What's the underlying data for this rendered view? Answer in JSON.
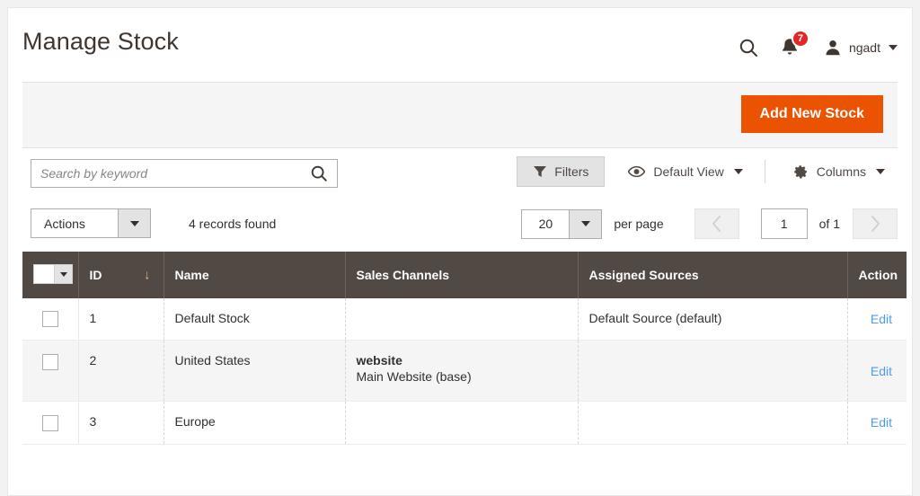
{
  "header": {
    "title": "Manage Stock",
    "search_icon": "search-icon",
    "notifications": {
      "icon": "bell-icon",
      "count": "7"
    },
    "user": {
      "avatar_icon": "user-icon",
      "name": "ngadt",
      "caret_icon": "chevron-down-icon"
    }
  },
  "action_band": {
    "add_new_stock_label": "Add New Stock",
    "primary_color": "#eb5202"
  },
  "toolbar": {
    "search_placeholder": "Search by keyword",
    "search_value": "",
    "search_icon": "search-icon",
    "filters_label": "Filters",
    "filters_icon": "funnel-icon",
    "view_label": "Default View",
    "view_icon": "eye-icon",
    "view_caret": "chevron-down-icon",
    "columns_label": "Columns",
    "columns_icon": "gear-icon",
    "columns_caret": "chevron-down-icon"
  },
  "pager_row": {
    "actions_label": "Actions",
    "records_found": "4 records found",
    "per_page_value": "20",
    "per_page_label": "per page",
    "prev_icon": "chevron-left-icon",
    "next_icon": "chevron-right-icon",
    "current_page": "1",
    "of_label": "of 1"
  },
  "grid": {
    "columns": [
      {
        "key": "check",
        "label": ""
      },
      {
        "key": "id",
        "label": "ID",
        "sorted": "desc",
        "sort_icon": "arrow-down-icon"
      },
      {
        "key": "name",
        "label": "Name"
      },
      {
        "key": "channels",
        "label": "Sales Channels"
      },
      {
        "key": "sources",
        "label": "Assigned Sources"
      },
      {
        "key": "action",
        "label": "Action"
      }
    ],
    "rows": [
      {
        "id": "1",
        "name": "Default Stock",
        "channel_label": "",
        "channel_value": "",
        "sources": "Default Source (default)",
        "action": "Edit"
      },
      {
        "id": "2",
        "name": "United States",
        "channel_label": "website",
        "channel_value": "Main Website (base)",
        "sources": "",
        "action": "Edit"
      },
      {
        "id": "3",
        "name": "Europe",
        "channel_label": "",
        "channel_value": "",
        "sources": "",
        "action": "Edit"
      }
    ]
  }
}
